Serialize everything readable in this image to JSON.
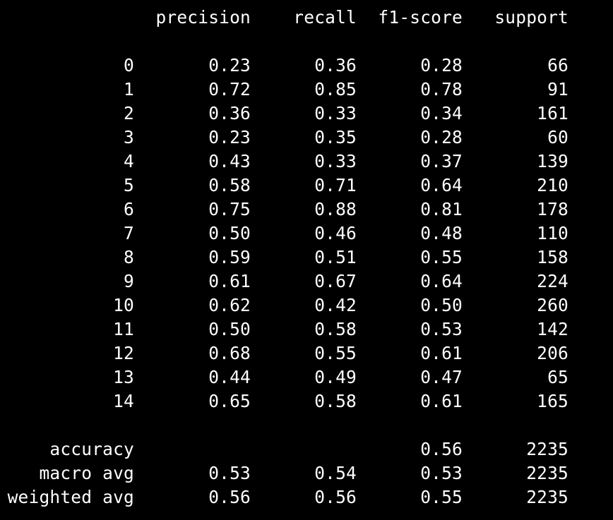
{
  "report": {
    "headers": [
      "precision",
      "recall",
      "f1-score",
      "support"
    ],
    "class_rows": [
      [
        "0",
        "0.23",
        "0.36",
        "0.28",
        "66"
      ],
      [
        "1",
        "0.72",
        "0.85",
        "0.78",
        "91"
      ],
      [
        "2",
        "0.36",
        "0.33",
        "0.34",
        "161"
      ],
      [
        "3",
        "0.23",
        "0.35",
        "0.28",
        "60"
      ],
      [
        "4",
        "0.43",
        "0.33",
        "0.37",
        "139"
      ],
      [
        "5",
        "0.58",
        "0.71",
        "0.64",
        "210"
      ],
      [
        "6",
        "0.75",
        "0.88",
        "0.81",
        "178"
      ],
      [
        "7",
        "0.50",
        "0.46",
        "0.48",
        "110"
      ],
      [
        "8",
        "0.59",
        "0.51",
        "0.55",
        "158"
      ],
      [
        "9",
        "0.61",
        "0.67",
        "0.64",
        "224"
      ],
      [
        "10",
        "0.62",
        "0.42",
        "0.50",
        "260"
      ],
      [
        "11",
        "0.50",
        "0.58",
        "0.53",
        "142"
      ],
      [
        "12",
        "0.68",
        "0.55",
        "0.61",
        "206"
      ],
      [
        "13",
        "0.44",
        "0.49",
        "0.47",
        "65"
      ],
      [
        "14",
        "0.65",
        "0.58",
        "0.61",
        "165"
      ]
    ],
    "summary_rows": [
      [
        "accuracy",
        "",
        "",
        "0.56",
        "2235"
      ],
      [
        "macro avg",
        "0.53",
        "0.54",
        "0.53",
        "2235"
      ],
      [
        "weighted avg",
        "0.56",
        "0.56",
        "0.55",
        "2235"
      ]
    ]
  },
  "colors": {
    "background": "#000000",
    "text": "#ffffff"
  }
}
